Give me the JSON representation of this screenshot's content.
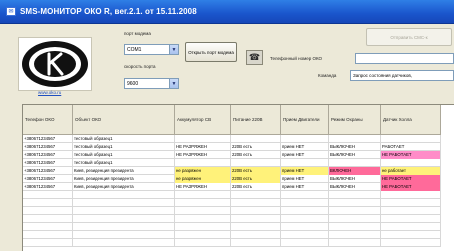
{
  "window": {
    "title": "SMS-МОНИТОР ОКО R, вег.2.1. от 15.11.2008"
  },
  "logo": {
    "link_text": "www.oko.ru"
  },
  "connection": {
    "port_label": "порт модема",
    "port_value": "COM1",
    "speed_label": "скорость порта",
    "speed_value": "9600",
    "open_port_button": "Открыть порт модема"
  },
  "sms": {
    "send_button": "Отправить СМС-к",
    "phone_label": "Телефонный номер ОКО",
    "phone_value": "",
    "command_label": "Команда",
    "command_value": "Запрос состояния датчиков,"
  },
  "table": {
    "columns": [
      "Телефон ОКО",
      "Объект ОКО",
      "Аккумулятор СВ",
      "Питание 220В",
      "Прием Двигатели",
      "Режим Охраны",
      "Датчик Холла"
    ],
    "rows": [
      [
        "+380671234567",
        "тестовый образец1",
        "",
        "",
        "",
        "",
        ""
      ],
      [
        "+380671234567",
        "тестовый образец1",
        "НЕ РАЗРЯЖЕН",
        "220В есть",
        "прием НЕТ",
        "ВЫКЛЮЧЕН",
        "РАБОТАЕТ"
      ],
      [
        "+380671234567",
        "тестовый образец1",
        "НЕ РАЗРЯЖЕН",
        "220В есть",
        "прием НЕТ",
        "ВЫКЛЮЧЕН",
        "НЕ РАБОТАЕТ"
      ],
      [
        "+380671234567",
        "тестовый образец1",
        "",
        "",
        "",
        "",
        ""
      ],
      [
        "+380671234567",
        "Киев, резиденция президента",
        "не разряжен",
        "220В есть",
        "прием НЕТ",
        "ВКЛЮЧЕН",
        "не работает"
      ],
      [
        "+380671234567",
        "Киев, резиденция президента",
        "не разряжен",
        "220В есть",
        "прием НЕТ",
        "ВЫКЛЮЧЕН",
        "НЕ РАБОТАЕТ"
      ],
      [
        "+380671234567",
        "Киев, резиденция президента",
        "НЕ РАЗРЯЖЕН",
        "220В есть",
        "прием НЕТ",
        "ВЫКЛЮЧЕН",
        "НЕ РАБОТАЕТ"
      ]
    ],
    "row_colors": [
      [
        "",
        "",
        "",
        "",
        "",
        "",
        ""
      ],
      [
        "",
        "",
        "",
        "",
        "",
        "",
        ""
      ],
      [
        "",
        "",
        "",
        "",
        "",
        "",
        "#ff8cc8"
      ],
      [
        "",
        "",
        "",
        "",
        "",
        "",
        ""
      ],
      [
        "",
        "",
        "#fff27a",
        "#fff27a",
        "#fff27a",
        "#ff6a9a",
        "#fff27a"
      ],
      [
        "",
        "",
        "#fff27a",
        "#fff27a",
        "",
        "",
        "#ff6a9a"
      ],
      [
        "",
        "",
        "",
        "",
        "",
        "",
        "#ff6a9a"
      ]
    ]
  },
  "colors": {
    "titlebar": "#1a55cc",
    "alert_pink": "#ff6a9a",
    "warn_yellow": "#fff27a"
  }
}
